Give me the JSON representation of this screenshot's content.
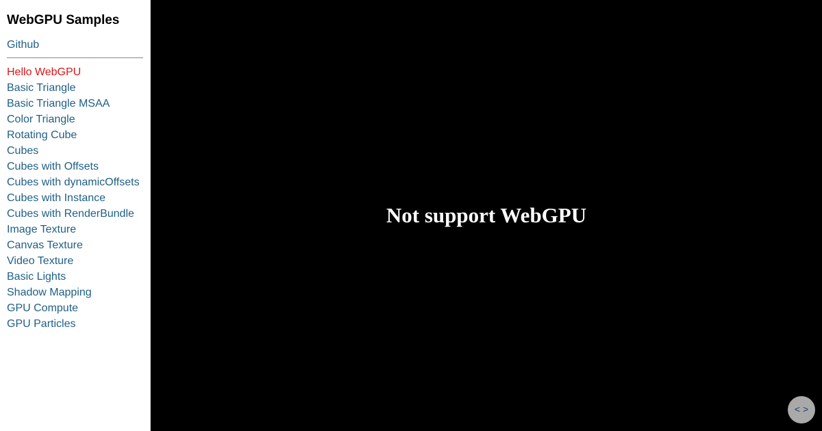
{
  "sidebar": {
    "title": "WebGPU Samples",
    "github_label": "Github",
    "items": [
      {
        "label": "Hello WebGPU",
        "active": true
      },
      {
        "label": "Basic Triangle",
        "active": false
      },
      {
        "label": "Basic Triangle MSAA",
        "active": false
      },
      {
        "label": "Color Triangle",
        "active": false
      },
      {
        "label": "Rotating Cube",
        "active": false
      },
      {
        "label": "Cubes",
        "active": false
      },
      {
        "label": "Cubes with Offsets",
        "active": false
      },
      {
        "label": "Cubes with dynamicOffsets",
        "active": false
      },
      {
        "label": "Cubes with Instance",
        "active": false
      },
      {
        "label": "Cubes with RenderBundle",
        "active": false
      },
      {
        "label": "Image Texture",
        "active": false
      },
      {
        "label": "Canvas Texture",
        "active": false
      },
      {
        "label": "Video Texture",
        "active": false
      },
      {
        "label": "Basic Lights",
        "active": false
      },
      {
        "label": "Shadow Mapping",
        "active": false
      },
      {
        "label": "GPU Compute",
        "active": false
      },
      {
        "label": "GPU Particles",
        "active": false
      }
    ]
  },
  "main": {
    "message": "Not support WebGPU",
    "code_toggle_label": "< >",
    "code_toggle_icon": "code-icon"
  },
  "colors": {
    "link": "#1f5f86",
    "active_link": "#e01414",
    "canvas_background": "#000000",
    "message_text": "#ffffff",
    "toggle_background": "#a9a9a9"
  }
}
